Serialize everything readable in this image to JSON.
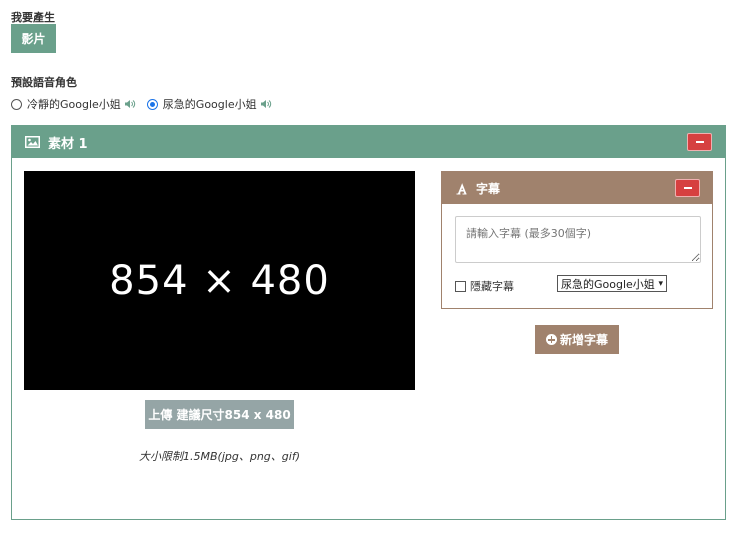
{
  "produce": {
    "label": "我要產生",
    "video_button": "影片"
  },
  "voice": {
    "label": "預設語音角色",
    "options": [
      {
        "label": "冷靜的Google小姐",
        "checked": false
      },
      {
        "label": "尿急的Google小姐",
        "checked": true
      }
    ]
  },
  "material": {
    "title": "素材 1",
    "media_placeholder": "854 × 480",
    "upload_button": "上傳 建議尺寸854 x 480",
    "size_note": "大小限制1.5MB(jpg、png、gif)"
  },
  "subtitle": {
    "title": "字幕",
    "input_placeholder": "請輸入字幕 (最多30個字)",
    "hide_label": "隱藏字幕",
    "voice_selected": "尿急的Google小姐",
    "add_button": "新增字幕"
  },
  "colors": {
    "green": "#6aa08b",
    "brown": "#a0826d",
    "red": "#d64040",
    "gray": "#95a5a6"
  }
}
